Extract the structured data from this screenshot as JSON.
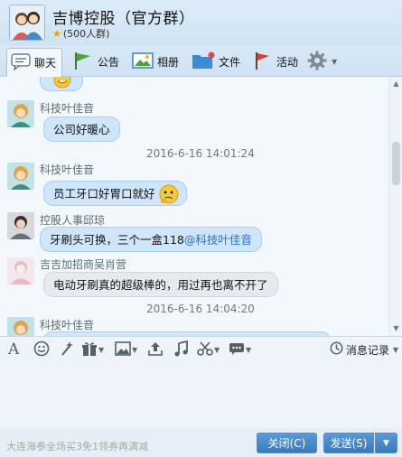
{
  "header": {
    "title": "吉博控股（官方群）",
    "member_count": "(500人群)"
  },
  "tabs": [
    {
      "label": "聊天",
      "icon": "chat-bubble-icon"
    },
    {
      "label": "公告",
      "icon": "announcement-flag-icon"
    },
    {
      "label": "相册",
      "icon": "album-picture-icon"
    },
    {
      "label": "文件",
      "icon": "folder-icon"
    },
    {
      "label": "活动",
      "icon": "event-flag-icon"
    },
    {
      "label": "",
      "icon": "gear-icon"
    }
  ],
  "messages": [
    {
      "sender": "科技叶佳音",
      "text": "公司好暖心"
    },
    {
      "timestamp": "2016-6-16 14:01:24"
    },
    {
      "sender": "科技叶佳音",
      "text": "员工牙口好胃口就好"
    },
    {
      "sender": "控股人事邱琼",
      "text": "牙刷头可换，三个一盒118",
      "mention": "@科技叶佳音"
    },
    {
      "sender": "吉吉加招商吴肖营",
      "text": "电动牙刷真的超级棒的，用过再也离不开了"
    },
    {
      "timestamp": "2016-6-16 14:04:20"
    },
    {
      "sender": "科技叶佳音"
    }
  ],
  "toolbar": {
    "history_label": "消息记录"
  },
  "footer": {
    "ad_text": "大连海参全场买3免1领券再满减",
    "close_label": "关闭(C)",
    "send_label": "发送(S)"
  },
  "colors": {
    "bubble_blue": "#cfe6fa",
    "bubble_gray": "#e6e9ee",
    "button_blue": "#3a79bc",
    "mention_blue": "#2a6fd0"
  }
}
